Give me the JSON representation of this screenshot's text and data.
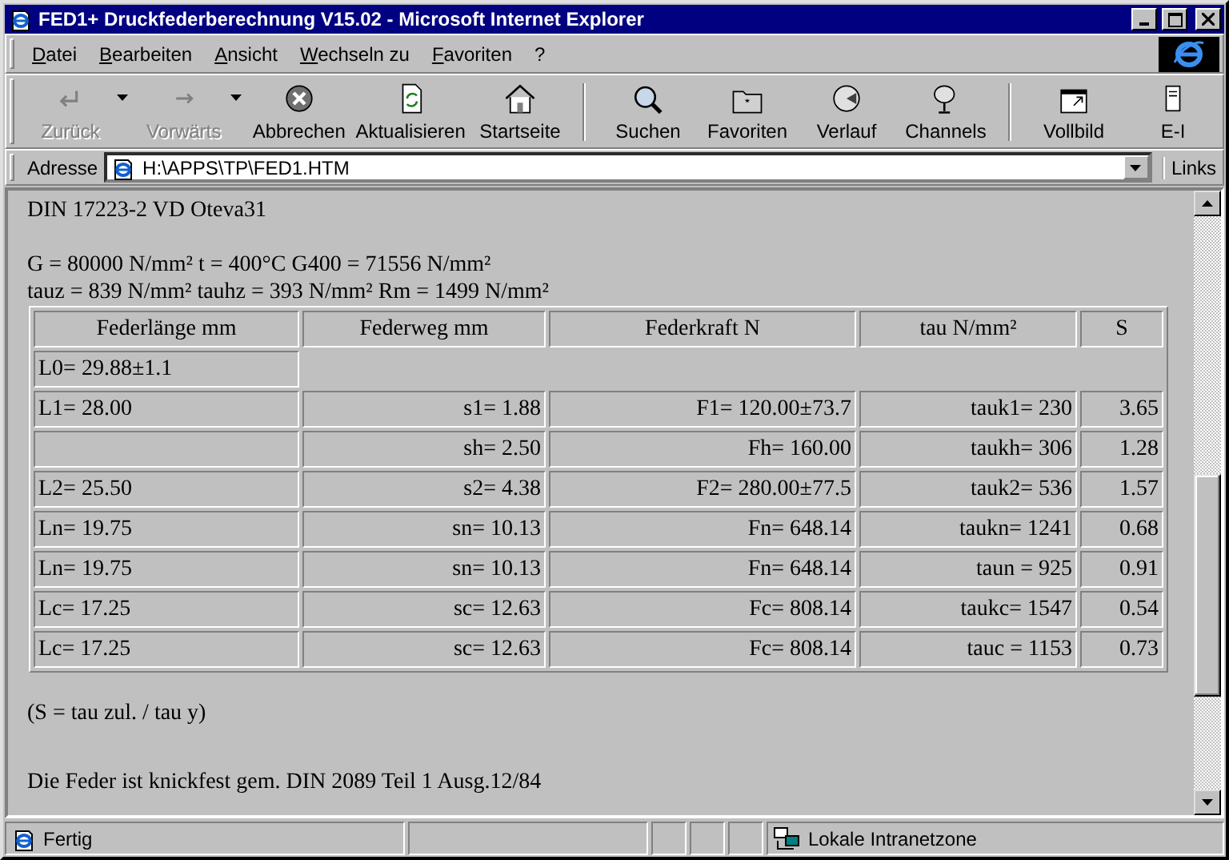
{
  "window": {
    "title": "FED1+ Druckfederberechnung V15.02 - Microsoft Internet Explorer"
  },
  "menu": [
    "Datei",
    "Bearbeiten",
    "Ansicht",
    "Wechseln zu",
    "Favoriten",
    "?"
  ],
  "toolbar": [
    {
      "label": "Zurück",
      "disabled": true
    },
    {
      "label": "Vorwärts",
      "disabled": true
    },
    {
      "label": "Abbrechen",
      "disabled": false
    },
    {
      "label": "Aktualisieren",
      "disabled": false
    },
    {
      "label": "Startseite",
      "disabled": false
    },
    {
      "label": "Suchen",
      "disabled": false
    },
    {
      "label": "Favoriten",
      "disabled": false
    },
    {
      "label": "Verlauf",
      "disabled": false
    },
    {
      "label": "Channels",
      "disabled": false
    },
    {
      "label": "Vollbild",
      "disabled": false
    },
    {
      "label": "E-I",
      "disabled": false
    }
  ],
  "address": {
    "label": "Adresse",
    "value": "H:\\APPS\\TP\\FED1.HTM",
    "links": "Links"
  },
  "content": {
    "heading": "DIN 17223-2 VD Oteva31",
    "params": [
      "G = 80000 N/mm² t = 400°C G400 = 71556 N/mm²",
      "tauz = 839 N/mm² tauhz = 393 N/mm² Rm = 1499 N/mm²"
    ],
    "table": {
      "columns": [
        "Federlänge mm",
        "Federweg mm",
        "Federkraft N",
        "tau N/mm²",
        "S"
      ],
      "rows": [
        {
          "cells": [
            "L0= 29.88±1.1"
          ]
        },
        {
          "cells": [
            "L1= 28.00",
            "s1= 1.88",
            "F1= 120.00±73.7",
            "tauk1= 230",
            "3.65"
          ]
        },
        {
          "cells": [
            "",
            "sh= 2.50",
            "Fh= 160.00",
            "taukh= 306",
            "1.28"
          ]
        },
        {
          "cells": [
            "L2= 25.50",
            "s2= 4.38",
            "F2= 280.00±77.5",
            "tauk2= 536",
            "1.57"
          ]
        },
        {
          "cells": [
            "Ln= 19.75",
            "sn= 10.13",
            "Fn= 648.14",
            "taukn= 1241",
            "0.68"
          ]
        },
        {
          "cells": [
            "Ln= 19.75",
            "sn= 10.13",
            "Fn= 648.14",
            "taun = 925",
            "0.91"
          ]
        },
        {
          "cells": [
            "Lc= 17.25",
            "sc= 12.63",
            "Fc= 808.14",
            "taukc= 1547",
            "0.54"
          ]
        },
        {
          "cells": [
            "Lc= 17.25",
            "sc= 12.63",
            "Fc= 808.14",
            "tauc = 1153",
            "0.73"
          ]
        }
      ]
    },
    "note": "(S = tau zul. / tau y)",
    "footer": "Die Feder ist knickfest gem. DIN 2089 Teil 1 Ausg.12/84"
  },
  "status": {
    "text": "Fertig",
    "zone": "Lokale Intranetzone"
  }
}
